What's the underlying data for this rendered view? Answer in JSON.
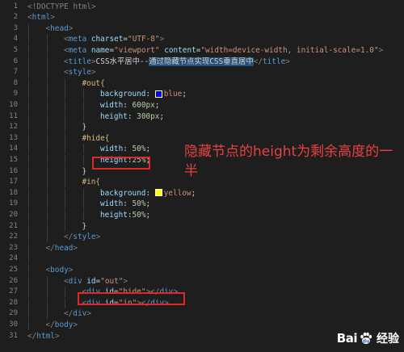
{
  "lines": [
    {
      "num": "1",
      "indent": 0,
      "tokens": [
        {
          "t": "<!DOCTYPE html>",
          "c": "punc"
        }
      ]
    },
    {
      "num": "2",
      "indent": 0,
      "tokens": [
        {
          "t": "<",
          "c": "punc"
        },
        {
          "t": "html",
          "c": "tag"
        },
        {
          "t": ">",
          "c": "punc"
        }
      ]
    },
    {
      "num": "3",
      "indent": 1,
      "tokens": [
        {
          "t": "<",
          "c": "punc"
        },
        {
          "t": "head",
          "c": "tag"
        },
        {
          "t": ">",
          "c": "punc"
        }
      ]
    },
    {
      "num": "4",
      "indent": 2,
      "tokens": [
        {
          "t": "<",
          "c": "punc"
        },
        {
          "t": "meta",
          "c": "tag"
        },
        {
          "t": " charset",
          "c": "attr"
        },
        {
          "t": "=",
          "c": "txt"
        },
        {
          "t": "\"UTF-8\"",
          "c": "str"
        },
        {
          "t": ">",
          "c": "punc"
        }
      ]
    },
    {
      "num": "5",
      "indent": 2,
      "tokens": [
        {
          "t": "<",
          "c": "punc"
        },
        {
          "t": "meta",
          "c": "tag"
        },
        {
          "t": " name",
          "c": "attr"
        },
        {
          "t": "=",
          "c": "txt"
        },
        {
          "t": "\"viewport\"",
          "c": "str"
        },
        {
          "t": " content",
          "c": "attr"
        },
        {
          "t": "=",
          "c": "txt"
        },
        {
          "t": "\"width=device-width, initial-scale=1.0\"",
          "c": "str"
        },
        {
          "t": ">",
          "c": "punc"
        }
      ]
    },
    {
      "num": "6",
      "indent": 2,
      "tokens": [
        {
          "t": "<",
          "c": "punc"
        },
        {
          "t": "title",
          "c": "tag"
        },
        {
          "t": ">",
          "c": "punc"
        },
        {
          "t": "CSS水平居中--",
          "c": "txt"
        },
        {
          "t": "通过隐藏节点实现CSS垂直居中",
          "c": "txt",
          "hl": true
        },
        {
          "t": "</",
          "c": "punc"
        },
        {
          "t": "title",
          "c": "tag"
        },
        {
          "t": ">",
          "c": "punc"
        }
      ]
    },
    {
      "num": "7",
      "indent": 2,
      "tokens": [
        {
          "t": "<",
          "c": "punc"
        },
        {
          "t": "style",
          "c": "tag"
        },
        {
          "t": ">",
          "c": "punc"
        }
      ]
    },
    {
      "num": "8",
      "indent": 3,
      "tokens": [
        {
          "t": "#out{",
          "c": "sel"
        }
      ]
    },
    {
      "num": "9",
      "indent": 4,
      "tokens": [
        {
          "t": "background",
          "c": "prop"
        },
        {
          "t": ": ",
          "c": "txt"
        },
        {
          "swatch": "#0000ff"
        },
        {
          "t": "blue",
          "c": "val"
        },
        {
          "t": ";",
          "c": "txt"
        }
      ]
    },
    {
      "num": "10",
      "indent": 4,
      "tokens": [
        {
          "t": "width",
          "c": "prop"
        },
        {
          "t": ": ",
          "c": "txt"
        },
        {
          "t": "600px",
          "c": "num"
        },
        {
          "t": ";",
          "c": "txt"
        }
      ]
    },
    {
      "num": "11",
      "indent": 4,
      "tokens": [
        {
          "t": "height",
          "c": "prop"
        },
        {
          "t": ": ",
          "c": "txt"
        },
        {
          "t": "300px",
          "c": "num"
        },
        {
          "t": ";",
          "c": "txt"
        }
      ]
    },
    {
      "num": "12",
      "indent": 3,
      "tokens": [
        {
          "t": "}",
          "c": "txt"
        }
      ]
    },
    {
      "num": "13",
      "indent": 3,
      "tokens": [
        {
          "t": "#hide{",
          "c": "sel"
        }
      ]
    },
    {
      "num": "14",
      "indent": 4,
      "tokens": [
        {
          "t": "width",
          "c": "prop"
        },
        {
          "t": ": ",
          "c": "txt"
        },
        {
          "t": "50%",
          "c": "num"
        },
        {
          "t": ";",
          "c": "txt"
        }
      ]
    },
    {
      "num": "15",
      "indent": 4,
      "tokens": [
        {
          "t": "height",
          "c": "prop"
        },
        {
          "t": ":",
          "c": "txt"
        },
        {
          "t": "25%",
          "c": "num"
        },
        {
          "t": ";",
          "c": "txt"
        }
      ]
    },
    {
      "num": "16",
      "indent": 3,
      "tokens": [
        {
          "t": "}",
          "c": "txt"
        }
      ]
    },
    {
      "num": "17",
      "indent": 3,
      "tokens": [
        {
          "t": "#in{",
          "c": "sel"
        }
      ]
    },
    {
      "num": "18",
      "indent": 4,
      "tokens": [
        {
          "t": "background",
          "c": "prop"
        },
        {
          "t": ": ",
          "c": "txt"
        },
        {
          "swatch": "#ffff00"
        },
        {
          "t": "yellow",
          "c": "val"
        },
        {
          "t": ";",
          "c": "txt"
        }
      ]
    },
    {
      "num": "19",
      "indent": 4,
      "tokens": [
        {
          "t": "width",
          "c": "prop"
        },
        {
          "t": ": ",
          "c": "txt"
        },
        {
          "t": "50%",
          "c": "num"
        },
        {
          "t": ";",
          "c": "txt"
        }
      ]
    },
    {
      "num": "20",
      "indent": 4,
      "tokens": [
        {
          "t": "height",
          "c": "prop"
        },
        {
          "t": ":",
          "c": "txt"
        },
        {
          "t": "50%",
          "c": "num"
        },
        {
          "t": ";",
          "c": "txt"
        }
      ]
    },
    {
      "num": "21",
      "indent": 3,
      "tokens": [
        {
          "t": "}",
          "c": "txt"
        }
      ]
    },
    {
      "num": "22",
      "indent": 2,
      "tokens": [
        {
          "t": "</",
          "c": "punc"
        },
        {
          "t": "style",
          "c": "tag"
        },
        {
          "t": ">",
          "c": "punc"
        }
      ]
    },
    {
      "num": "23",
      "indent": 1,
      "tokens": [
        {
          "t": "</",
          "c": "punc"
        },
        {
          "t": "head",
          "c": "tag"
        },
        {
          "t": ">",
          "c": "punc"
        }
      ]
    },
    {
      "num": "24",
      "indent": 1,
      "tokens": []
    },
    {
      "num": "25",
      "indent": 1,
      "tokens": [
        {
          "t": "<",
          "c": "punc"
        },
        {
          "t": "body",
          "c": "tag"
        },
        {
          "t": ">",
          "c": "punc"
        }
      ]
    },
    {
      "num": "26",
      "indent": 2,
      "tokens": [
        {
          "t": "<",
          "c": "punc"
        },
        {
          "t": "div",
          "c": "tag"
        },
        {
          "t": " id",
          "c": "attr"
        },
        {
          "t": "=",
          "c": "txt"
        },
        {
          "t": "\"out\"",
          "c": "str"
        },
        {
          "t": ">",
          "c": "punc"
        }
      ]
    },
    {
      "num": "27",
      "indent": 3,
      "tokens": [
        {
          "t": "<",
          "c": "punc"
        },
        {
          "t": "div",
          "c": "tag"
        },
        {
          "t": " id",
          "c": "attr"
        },
        {
          "t": "=",
          "c": "txt"
        },
        {
          "t": "\"hide\"",
          "c": "str"
        },
        {
          "t": "></",
          "c": "punc"
        },
        {
          "t": "div",
          "c": "tag"
        },
        {
          "t": ">",
          "c": "punc"
        }
      ]
    },
    {
      "num": "28",
      "indent": 3,
      "tokens": [
        {
          "t": "<",
          "c": "punc"
        },
        {
          "t": "div",
          "c": "tag"
        },
        {
          "t": " id",
          "c": "attr"
        },
        {
          "t": "=",
          "c": "txt"
        },
        {
          "t": "\"in\"",
          "c": "str"
        },
        {
          "t": "></",
          "c": "punc"
        },
        {
          "t": "div",
          "c": "tag"
        },
        {
          "t": ">",
          "c": "punc"
        }
      ]
    },
    {
      "num": "29",
      "indent": 2,
      "tokens": [
        {
          "t": "</",
          "c": "punc"
        },
        {
          "t": "div",
          "c": "tag"
        },
        {
          "t": ">",
          "c": "punc"
        }
      ]
    },
    {
      "num": "30",
      "indent": 1,
      "tokens": [
        {
          "t": "</",
          "c": "punc"
        },
        {
          "t": "body",
          "c": "tag"
        },
        {
          "t": ">",
          "c": "punc"
        }
      ]
    },
    {
      "num": "31",
      "indent": 0,
      "tokens": [
        {
          "t": "</",
          "c": "punc"
        },
        {
          "t": "html",
          "c": "tag"
        },
        {
          "t": ">",
          "c": "punc"
        }
      ]
    }
  ],
  "annotation": "隐藏节点的height为剩余高度的一半",
  "watermark": {
    "bai": "Bai",
    "du": "du",
    "jingyan": "经验"
  },
  "colors": {
    "background": "#1e1e1e",
    "annotation_red": "#e84141",
    "box_red": "#e02828",
    "selection": "#264f78"
  },
  "icons": {
    "watermark_logo": "baidu-paw-icon"
  }
}
